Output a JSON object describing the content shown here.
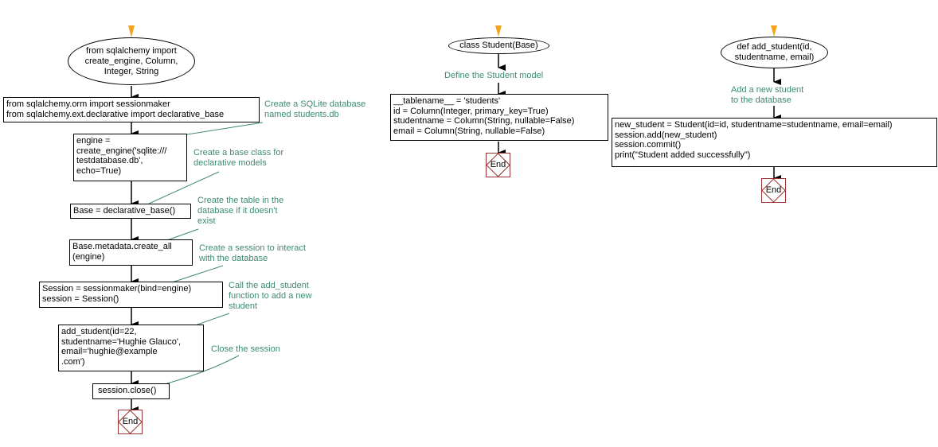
{
  "diagram_left": {
    "start": "from sqlalchemy import\ncreate_engine, Column,\nInteger, String",
    "steps": [
      "from sqlalchemy.orm import sessionmaker\nfrom sqlalchemy.ext.declarative import declarative_base",
      "engine =\ncreate_engine('sqlite:///\ntestdatabase.db',\necho=True)",
      "Base = declarative_base()",
      "Base.metadata.create_all\n(engine)",
      "Session = sessionmaker(bind=engine)\nsession = Session()",
      "add_student(id=22,\nstudentname='Hughie Glauco',\nemail='hughie@example\n.com')",
      "session.close()"
    ],
    "comments": [
      "Create a SQLite database\nnamed students.db",
      "Create a base class for\ndeclarative models",
      "Create the table in the\ndatabase if it doesn't\nexist",
      "Create a session to interact\nwith the database",
      "Call the add_student\nfunction to add a new\nstudent",
      "Close the session"
    ],
    "end": "End"
  },
  "diagram_middle": {
    "start": "class Student(Base)",
    "comment": "Define the Student model",
    "step": "__tablename__ = 'students'\nid = Column(Integer, primary_key=True)\nstudentname = Column(String, nullable=False)\nemail = Column(String, nullable=False)",
    "end": "End"
  },
  "diagram_right": {
    "start": "def add_student(id,\nstudentname, email)",
    "comment": "Add a new student\nto the database",
    "step": "new_student = Student(id=id, studentname=studentname, email=email)\nsession.add(new_student)\nsession.commit()\nprint(\"Student added successfully\")",
    "end": "End"
  },
  "colors": {
    "comment_text": "#3f8a6f",
    "start_arrow": "#f7a21b",
    "end_border": "#993333"
  }
}
